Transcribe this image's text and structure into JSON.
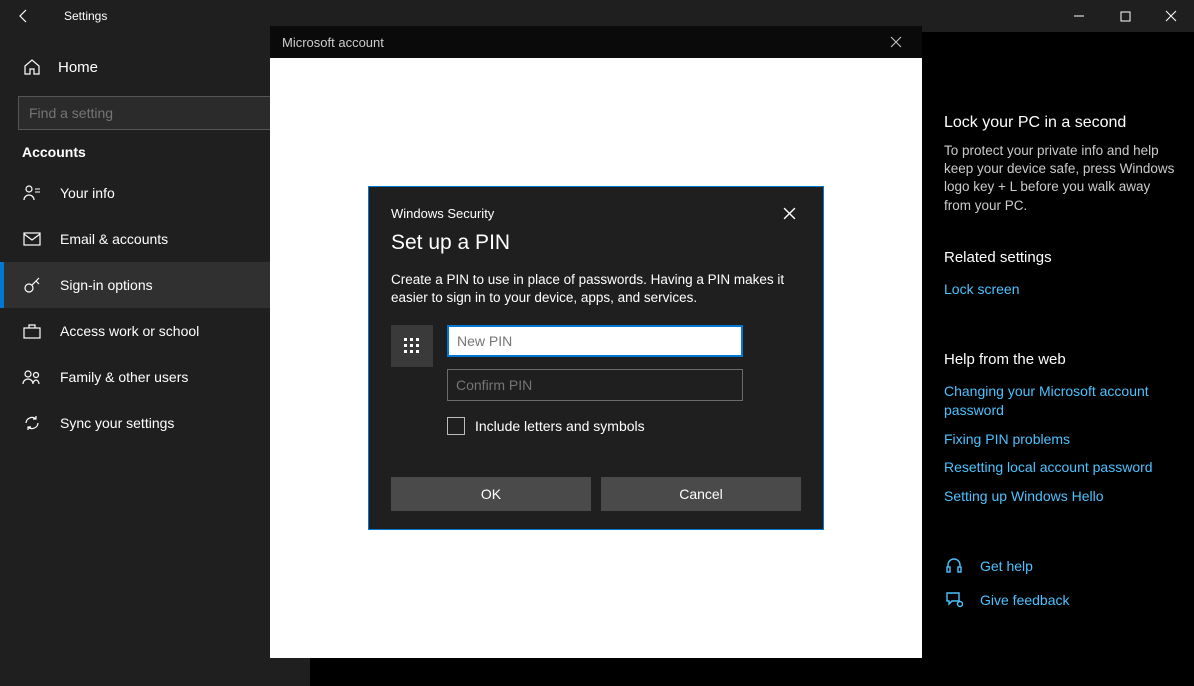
{
  "titlebar": {
    "title": "Settings"
  },
  "sidebar": {
    "home": "Home",
    "search_placeholder": "Find a setting",
    "section": "Accounts",
    "items": [
      {
        "label": "Your info"
      },
      {
        "label": "Email & accounts"
      },
      {
        "label": "Sign-in options"
      },
      {
        "label": "Access work or school"
      },
      {
        "label": "Family & other users"
      },
      {
        "label": "Sync your settings"
      }
    ]
  },
  "right": {
    "lock_title": "Lock your PC in a second",
    "lock_text": "To protect your private info and help keep your device safe, press Windows logo key + L before you walk away from your PC.",
    "related_title": "Related settings",
    "lockscreen_link": "Lock screen",
    "help_title": "Help from the web",
    "help_links": [
      "Changing your Microsoft account password",
      "Fixing PIN problems",
      "Resetting local account password",
      "Setting up Windows Hello"
    ],
    "get_help": "Get help",
    "give_feedback": "Give feedback"
  },
  "ms_modal": {
    "title": "Microsoft account"
  },
  "security_dialog": {
    "window_label": "Windows Security",
    "heading": "Set up a PIN",
    "description": "Create a PIN to use in place of passwords. Having a PIN makes it easier to sign in to your device, apps, and services.",
    "new_pin_placeholder": "New PIN",
    "confirm_pin_placeholder": "Confirm PIN",
    "include_label": "Include letters and symbols",
    "ok": "OK",
    "cancel": "Cancel"
  }
}
